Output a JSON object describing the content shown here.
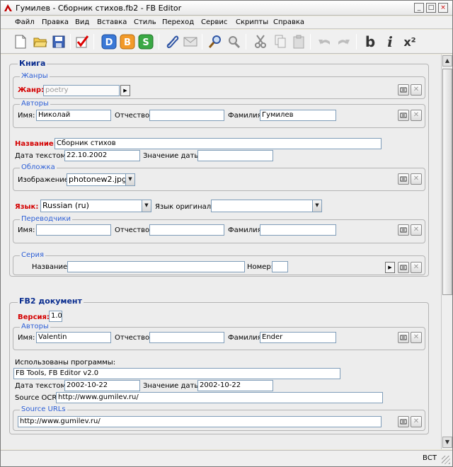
{
  "window": {
    "title": "Гумилев - Сборник стихов.fb2 - FB Editor",
    "buttons": {
      "minimize": "_",
      "maximize": "□",
      "close": "×"
    }
  },
  "menu": [
    "Файл",
    "Правка",
    "Вид",
    "Вставка",
    "Стиль",
    "Переход",
    "Сервис",
    "Скрипты",
    "Справка"
  ],
  "toolbar": {
    "buttons": [
      "new-icon",
      "open-icon",
      "save-icon",
      "validate-icon",
      "description-view-icon",
      "body-view-icon",
      "source-view-icon",
      "attach-icon",
      "mail-icon",
      "find-icon",
      "replace-icon",
      "cut-icon",
      "copy-icon",
      "paste-icon",
      "undo-icon",
      "redo-icon",
      "bold-icon",
      "italic-icon",
      "superscript-icon"
    ],
    "b_label": "b",
    "i_label": "i",
    "x2_label": "x²",
    "d_label": "D",
    "b2_label": "B",
    "s_label": "S"
  },
  "book": {
    "legend": "Книга",
    "genres": {
      "legend": "Жанры",
      "label": "Жанр:",
      "value": "poetry"
    },
    "authors": {
      "legend": "Авторы",
      "first_label": "Имя:",
      "first": "Николай",
      "middle_label": "Отчество:",
      "middle": "",
      "last_label": "Фамилия:",
      "last": "Гумилев"
    },
    "title_label": "Название:",
    "title": "Сборник стихов",
    "date_label": "Дата текстом:",
    "date": "22.10.2002",
    "date_value_label": "Значение даты:",
    "date_value": "",
    "cover": {
      "legend": "Обложка",
      "image_label": "Изображение:",
      "image": "photonew2.jpg"
    },
    "lang_label": "Язык:",
    "lang": "Russian (ru)",
    "src_lang_label": "Язык оригинала:",
    "src_lang": "",
    "translators": {
      "legend": "Переводчики",
      "first_label": "Имя:",
      "first": "",
      "middle_label": "Отчество:",
      "middle": "",
      "last_label": "Фамилия:",
      "last": ""
    },
    "series": {
      "legend": "Серия",
      "name_label": "Название:",
      "name": "",
      "number_label": "Номер:",
      "number": ""
    }
  },
  "fb2": {
    "legend": "FB2 документ",
    "version_label": "Версия:",
    "version": "1.0",
    "authors": {
      "legend": "Авторы",
      "first_label": "Имя:",
      "first": "Valentin",
      "middle_label": "Отчество:",
      "middle": "",
      "last_label": "Фамилия:",
      "last": "Ender"
    },
    "programs_label": "Использованы программы:",
    "programs": "FB Tools, FB Editor v2.0",
    "date_label": "Дата текстом:",
    "date": "2002-10-22",
    "date_value_label": "Значение даты:",
    "date_value": "2002-10-22",
    "ocr_label": "Source OCR:",
    "ocr": "http://www.gumilev.ru/",
    "urls": {
      "legend": "Source URLs",
      "value": "http://www.gumilev.ru/"
    }
  },
  "status": {
    "mode": "ВСТ"
  }
}
